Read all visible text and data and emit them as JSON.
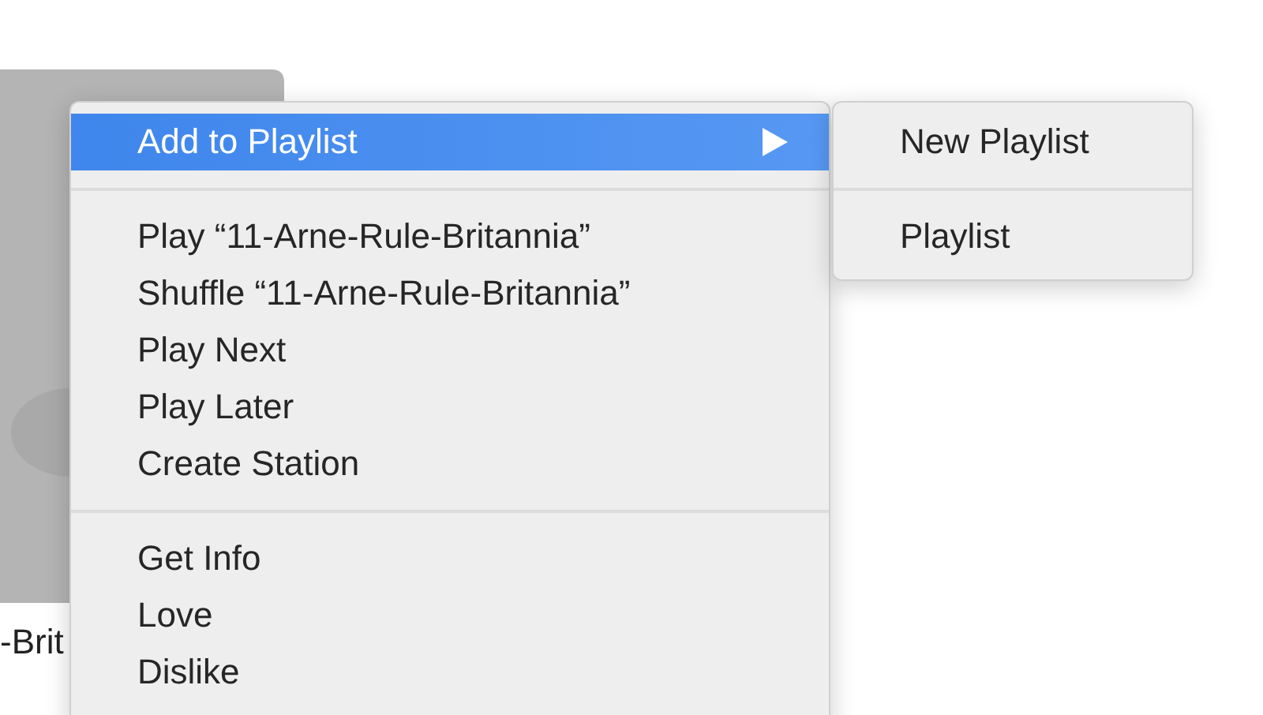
{
  "album": {
    "caption": "-Brit"
  },
  "context_menu": {
    "sections": [
      [
        {
          "label": "Add to Playlist",
          "selected": true,
          "has_submenu": true
        }
      ],
      [
        {
          "label": "Play “11-Arne-Rule-Britannia”",
          "selected": false,
          "has_submenu": false
        },
        {
          "label": "Shuffle “11-Arne-Rule-Britannia”",
          "selected": false,
          "has_submenu": false
        },
        {
          "label": "Play Next",
          "selected": false,
          "has_submenu": false
        },
        {
          "label": "Play Later",
          "selected": false,
          "has_submenu": false
        },
        {
          "label": "Create Station",
          "selected": false,
          "has_submenu": false
        }
      ],
      [
        {
          "label": "Get Info",
          "selected": false,
          "has_submenu": false
        },
        {
          "label": "Love",
          "selected": false,
          "has_submenu": false
        },
        {
          "label": "Dislike",
          "selected": false,
          "has_submenu": false
        }
      ]
    ]
  },
  "submenu": {
    "sections": [
      [
        {
          "label": "New Playlist",
          "selected": false
        }
      ],
      [
        {
          "label": "Playlist",
          "selected": false
        }
      ]
    ]
  }
}
